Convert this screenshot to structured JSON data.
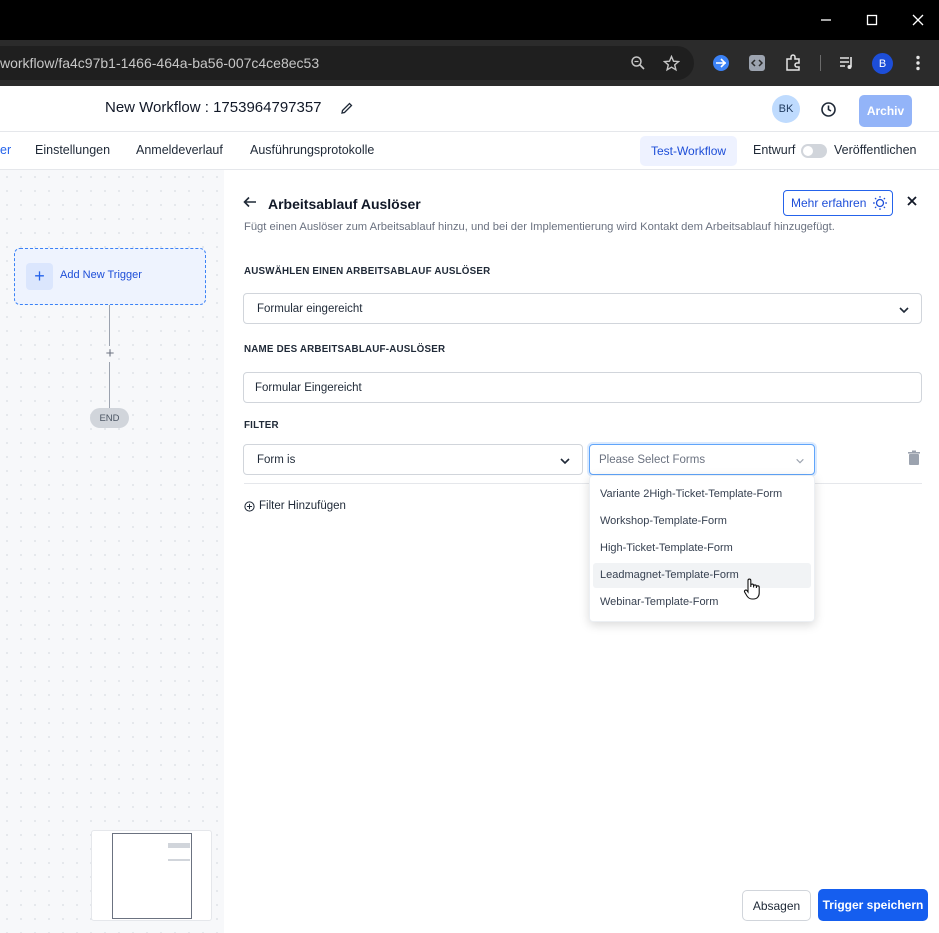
{
  "browser": {
    "url": "workflow/fa4c97b1-1466-464a-ba56-007c4ce8ec53",
    "profile_initial": "B"
  },
  "header": {
    "title": "New Workflow : 1753964797357",
    "avatar_initials": "BK",
    "archive_label": "Archiv"
  },
  "nav": {
    "partial_tab": "er",
    "tabs": [
      "Einstellungen",
      "Anmeldeverlauf",
      "Ausführungsprotokolle"
    ],
    "test_workflow": "Test-Workflow",
    "draft_label": "Entwurf",
    "publish_label": "Veröffentlichen",
    "published": false
  },
  "canvas": {
    "add_trigger": "Add New Trigger",
    "end_label": "END"
  },
  "panel": {
    "title": "Arbeitsablauf Auslöser",
    "subtitle": "Fügt einen Auslöser zum Arbeitsablauf hinzu, und bei der Implementierung wird Kontakt dem Arbeitsablauf hinzugefügt.",
    "learn_more": "Mehr erfahren",
    "select_trigger_label": "AUSWÄHLEN EINEN ARBEITSABLAUF AUSLÖSER",
    "selected_trigger": "Formular eingereicht",
    "trigger_name_label": "NAME DES ARBEITSABLAUF-AUSLÖSER",
    "trigger_name_value": "Formular Eingereicht",
    "filter_label": "FILTER",
    "filter_field": "Form is",
    "forms_placeholder": "Please Select Forms",
    "add_filter": "Filter Hinzufügen",
    "form_options": [
      "Variante 2High-Ticket-Template-Form",
      "Workshop-Template-Form",
      "High-Ticket-Template-Form",
      "Leadmagnet-Template-Form",
      "Webinar-Template-Form"
    ],
    "hovered_option": "Leadmagnet-Template-Form",
    "cancel_label": "Absagen",
    "save_label": "Trigger speichern"
  },
  "colors": {
    "primary": "#155eef",
    "archive": "#93b4f8",
    "trigger_border": "#3b82f6"
  }
}
